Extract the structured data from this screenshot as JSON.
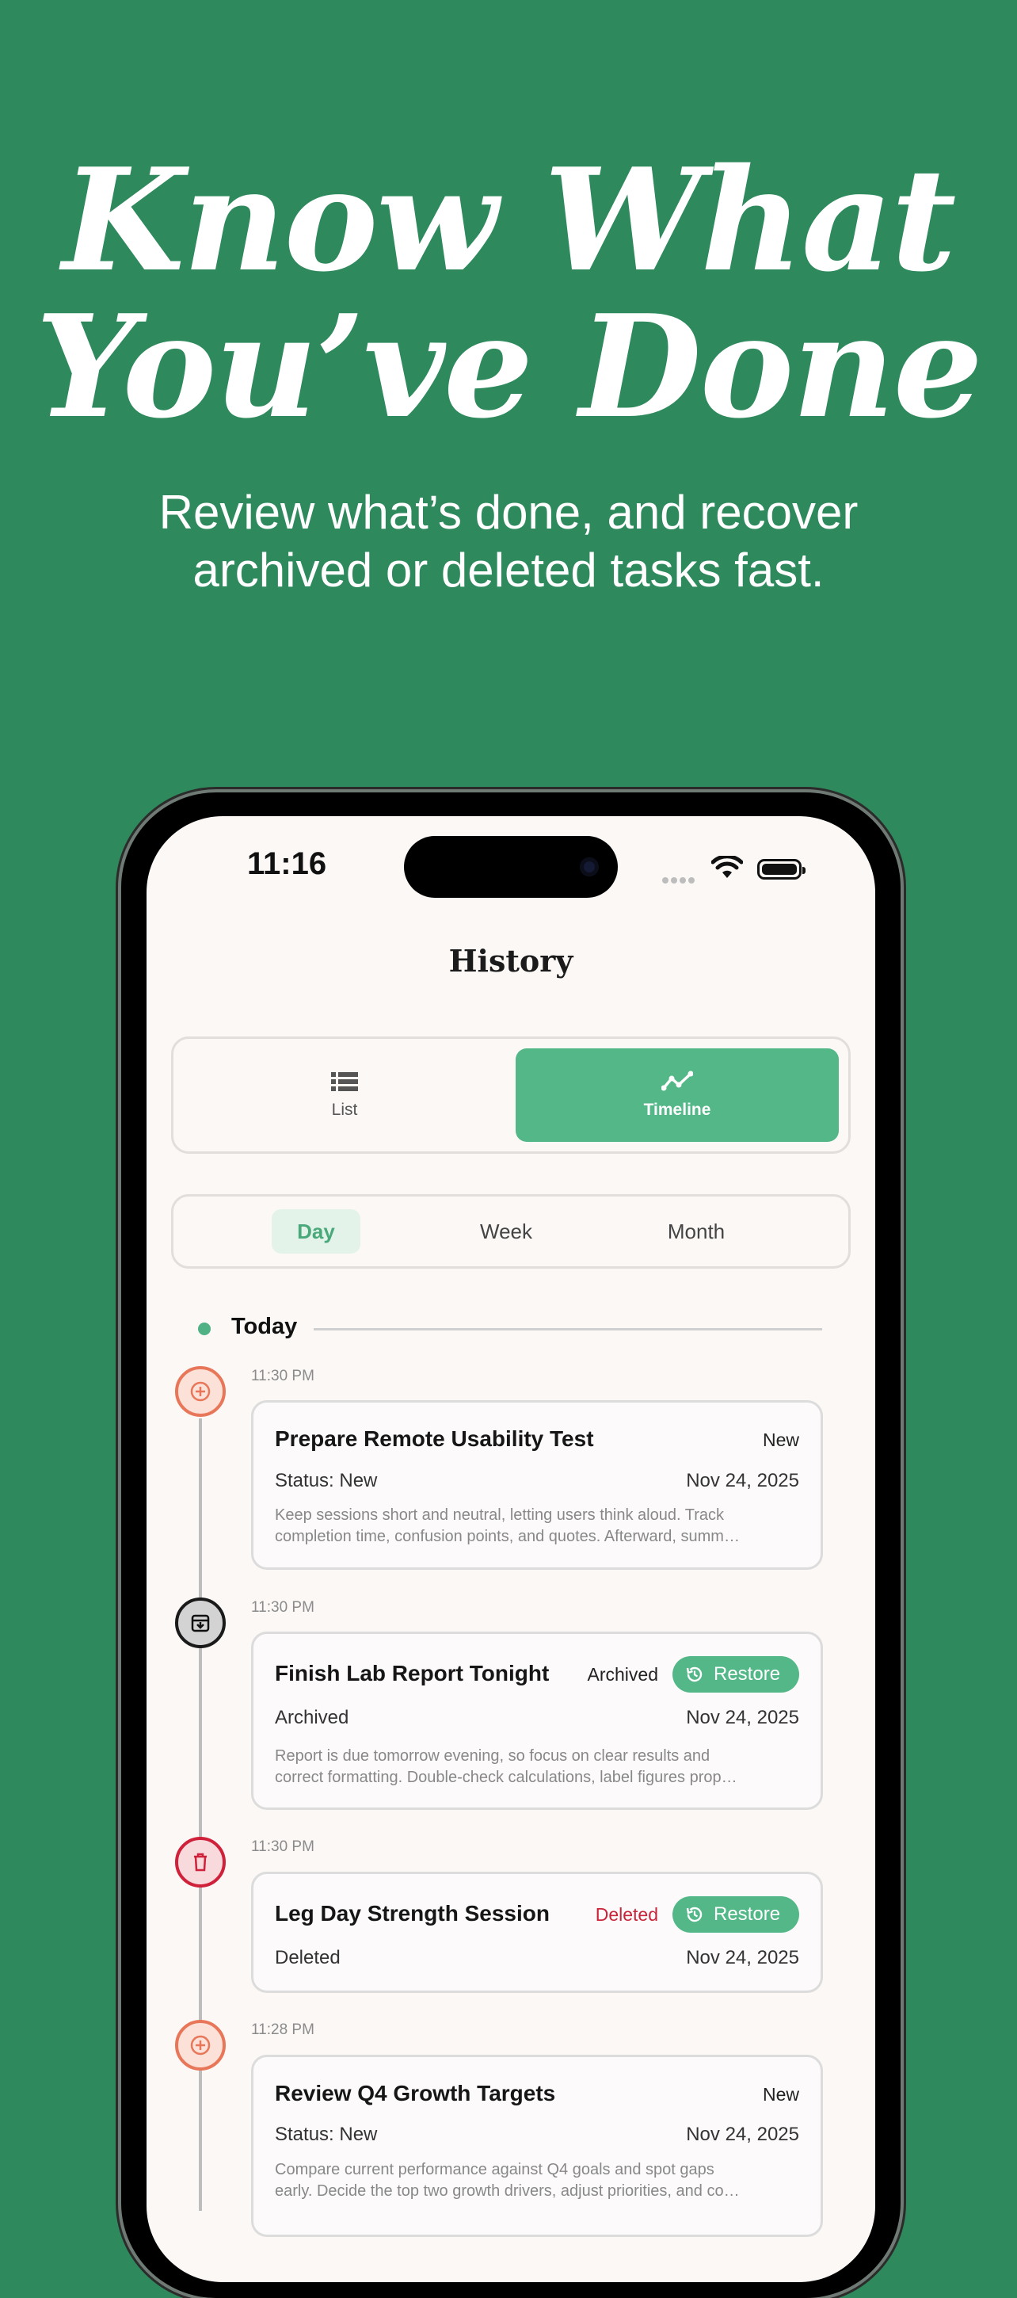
{
  "hero": {
    "title_line1": "Know What",
    "title_line2": "You’ve Done",
    "subtitle_line1": "Review what’s done, and recover",
    "subtitle_line2": "archived or deleted tasks fast."
  },
  "status_bar": {
    "time": "11:16"
  },
  "screen": {
    "title": "History",
    "view_toggle": [
      {
        "label": "List",
        "icon": "list-icon",
        "selected": false
      },
      {
        "label": "Timeline",
        "icon": "timeline-icon",
        "selected": true
      }
    ],
    "range_tabs": [
      {
        "label": "Day",
        "selected": true
      },
      {
        "label": "Week",
        "selected": false
      },
      {
        "label": "Month",
        "selected": false
      }
    ],
    "section_label": "Today"
  },
  "entries": [
    {
      "time": "11:30 PM",
      "kind": "new",
      "icon": "plus-circle-icon",
      "title": "Prepare Remote Usability Test",
      "badge": "New",
      "status": "Status: New",
      "date": "Nov 24, 2025",
      "desc_line1": "Keep sessions short and neutral, letting users think aloud. Track",
      "desc_line2": "completion time, confusion points, and quotes. Afterward, summ…"
    },
    {
      "time": "11:30 PM",
      "kind": "archived",
      "icon": "archive-icon",
      "title": "Finish Lab Report Tonight",
      "badge": "Archived",
      "restore_label": "Restore",
      "status": "Archived",
      "date": "Nov 24, 2025",
      "desc_line1": "Report is due tomorrow evening, so focus on clear results and",
      "desc_line2": "correct formatting. Double-check calculations, label figures prop…"
    },
    {
      "time": "11:30 PM",
      "kind": "deleted",
      "icon": "trash-icon",
      "title": "Leg Day Strength Session",
      "badge": "Deleted",
      "restore_label": "Restore",
      "status": "Deleted",
      "date": "Nov 24, 2025"
    },
    {
      "time": "11:28 PM",
      "kind": "new",
      "icon": "plus-circle-icon",
      "title": "Review Q4 Growth Targets",
      "badge": "New",
      "status": "Status: New",
      "date": "Nov 24, 2025",
      "desc_line1": "Compare current performance against Q4 goals and spot gaps",
      "desc_line2": "early. Decide the top two growth drivers, adjust priorities, and co…"
    }
  ],
  "colors": {
    "background": "#2e8a5c",
    "accent": "#53b788",
    "new": "#e8775a",
    "deleted": "#d0213a"
  }
}
